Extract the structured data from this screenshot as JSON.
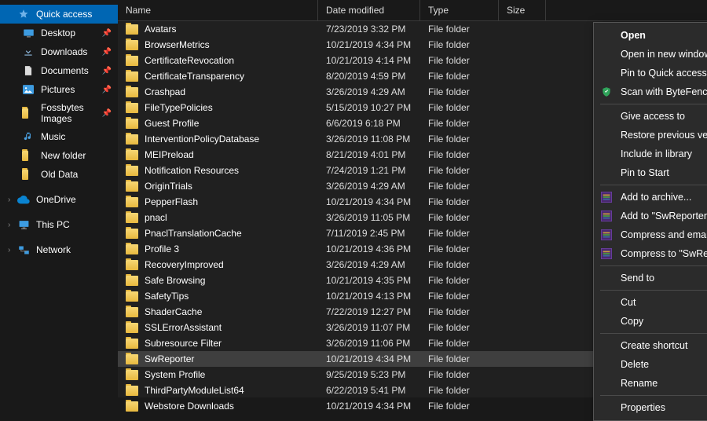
{
  "columns": {
    "name": "Name",
    "date": "Date modified",
    "type": "Type",
    "size": "Size"
  },
  "sidebar": {
    "quick_access": "Quick access",
    "items": [
      {
        "label": "Desktop",
        "pinned": true
      },
      {
        "label": "Downloads",
        "pinned": true
      },
      {
        "label": "Documents",
        "pinned": true
      },
      {
        "label": "Pictures",
        "pinned": true
      },
      {
        "label": "Fossbytes Images",
        "pinned": true
      },
      {
        "label": "Music",
        "pinned": false
      },
      {
        "label": "New folder",
        "pinned": false
      },
      {
        "label": "Old Data",
        "pinned": false
      }
    ],
    "onedrive": "OneDrive",
    "thispc": "This PC",
    "network": "Network"
  },
  "files": [
    {
      "name": "Avatars",
      "date": "7/23/2019 3:32 PM",
      "type": "File folder"
    },
    {
      "name": "BrowserMetrics",
      "date": "10/21/2019 4:34 PM",
      "type": "File folder"
    },
    {
      "name": "CertificateRevocation",
      "date": "10/21/2019 4:14 PM",
      "type": "File folder"
    },
    {
      "name": "CertificateTransparency",
      "date": "8/20/2019 4:59 PM",
      "type": "File folder"
    },
    {
      "name": "Crashpad",
      "date": "3/26/2019 4:29 AM",
      "type": "File folder"
    },
    {
      "name": "FileTypePolicies",
      "date": "5/15/2019 10:27 PM",
      "type": "File folder"
    },
    {
      "name": "Guest Profile",
      "date": "6/6/2019 6:18 PM",
      "type": "File folder"
    },
    {
      "name": "InterventionPolicyDatabase",
      "date": "3/26/2019 11:08 PM",
      "type": "File folder"
    },
    {
      "name": "MEIPreload",
      "date": "8/21/2019 4:01 PM",
      "type": "File folder"
    },
    {
      "name": "Notification Resources",
      "date": "7/24/2019 1:21 PM",
      "type": "File folder"
    },
    {
      "name": "OriginTrials",
      "date": "3/26/2019 4:29 AM",
      "type": "File folder"
    },
    {
      "name": "PepperFlash",
      "date": "10/21/2019 4:34 PM",
      "type": "File folder"
    },
    {
      "name": "pnacl",
      "date": "3/26/2019 11:05 PM",
      "type": "File folder"
    },
    {
      "name": "PnaclTranslationCache",
      "date": "7/11/2019 2:45 PM",
      "type": "File folder"
    },
    {
      "name": "Profile 3",
      "date": "10/21/2019 4:36 PM",
      "type": "File folder"
    },
    {
      "name": "RecoveryImproved",
      "date": "3/26/2019 4:29 AM",
      "type": "File folder"
    },
    {
      "name": "Safe Browsing",
      "date": "10/21/2019 4:35 PM",
      "type": "File folder"
    },
    {
      "name": "SafetyTips",
      "date": "10/21/2019 4:13 PM",
      "type": "File folder"
    },
    {
      "name": "ShaderCache",
      "date": "7/22/2019 12:27 PM",
      "type": "File folder"
    },
    {
      "name": "SSLErrorAssistant",
      "date": "3/26/2019 11:07 PM",
      "type": "File folder"
    },
    {
      "name": "Subresource Filter",
      "date": "3/26/2019 11:06 PM",
      "type": "File folder"
    },
    {
      "name": "SwReporter",
      "date": "10/21/2019 4:34 PM",
      "type": "File folder",
      "selected": true
    },
    {
      "name": "System Profile",
      "date": "9/25/2019 5:23 PM",
      "type": "File folder"
    },
    {
      "name": "ThirdPartyModuleList64",
      "date": "6/22/2019 5:41 PM",
      "type": "File folder"
    },
    {
      "name": "Webstore Downloads",
      "date": "10/21/2019 4:34 PM",
      "type": "File folder"
    }
  ],
  "context_menu": {
    "open": "Open",
    "open_new": "Open in new window",
    "pin_quick": "Pin to Quick access",
    "scan": "Scan with ByteFence Anti-Malware...",
    "give_access": "Give access to",
    "restore": "Restore previous versions",
    "include_lib": "Include in library",
    "pin_start": "Pin to Start",
    "add_archive": "Add to archive...",
    "add_rar": "Add to \"SwReporter.rar\"",
    "compress_email": "Compress and email...",
    "compress_rar_email": "Compress to \"SwReporter.rar\" and email",
    "send_to": "Send to",
    "cut": "Cut",
    "copy": "Copy",
    "shortcut": "Create shortcut",
    "delete": "Delete",
    "rename": "Rename",
    "properties": "Properties"
  }
}
